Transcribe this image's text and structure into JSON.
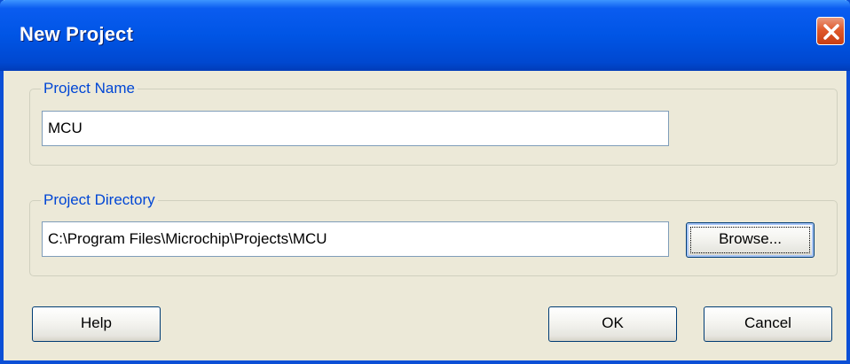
{
  "window": {
    "title": "New Project"
  },
  "project_name": {
    "label": "Project Name",
    "value": "MCU"
  },
  "project_directory": {
    "label": "Project Directory",
    "value": "C:\\Program Files\\Microchip\\Projects\\MCU",
    "browse_label": "Browse..."
  },
  "buttons": {
    "help_label": "Help",
    "ok_label": "OK",
    "cancel_label": "Cancel"
  },
  "colors": {
    "titlebar": "#0055e5",
    "group_label": "#0046d5",
    "close": "#e05a2c",
    "dialog_bg": "#ece9d8"
  }
}
